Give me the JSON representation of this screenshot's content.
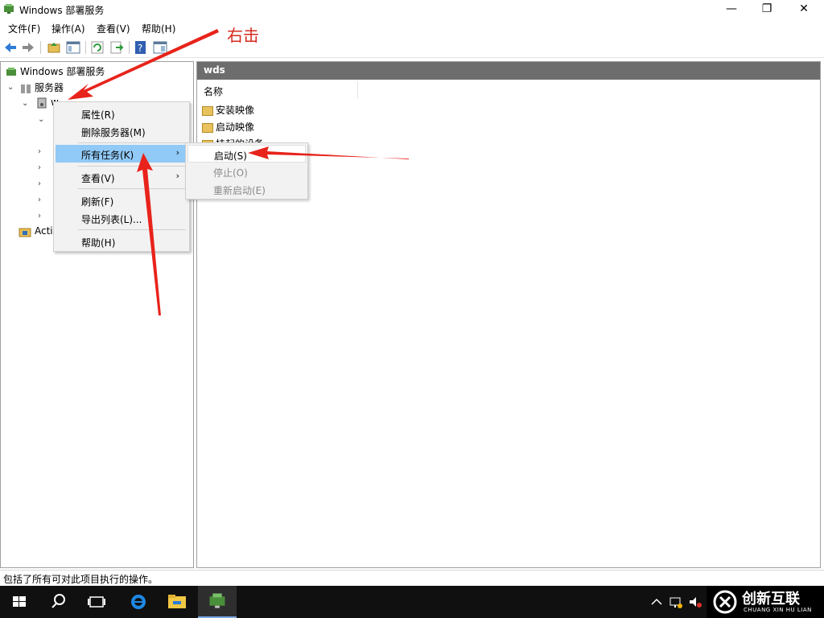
{
  "window": {
    "title": "Windows 部署服务",
    "minimize": "—",
    "restore": "❐",
    "close": "✕"
  },
  "menubar": [
    "文件(F)",
    "操作(A)",
    "查看(V)",
    "帮助(H)"
  ],
  "tree": {
    "root": "Windows 部署服务",
    "servers": "服务器",
    "server_node_partial": "w",
    "active_directory_partial": "Acti"
  },
  "right_pane": {
    "header": "wds",
    "column_name": "名称",
    "items": [
      "安装映像",
      "启动映像",
      "挂起的设备"
    ]
  },
  "context_menu": {
    "items": [
      "属性(R)",
      "删除服务器(M)",
      "所有任务(K)",
      "查看(V)",
      "刷新(F)",
      "导出列表(L)...",
      "帮助(H)"
    ],
    "submenu_arrow": "›"
  },
  "submenu": {
    "items": [
      "启动(S)",
      "停止(O)",
      "重新启动(E)"
    ]
  },
  "status_bar": "包括了所有可对此项目执行的操作。",
  "annotation": "右击",
  "watermark": {
    "brand": "创新互联",
    "sub": "CHUANG XIN HU LIAN"
  },
  "colors": {
    "arrow": "#e8231b",
    "menu_highlight": "#91c9f7",
    "pane_header": "#6d6d6d",
    "taskbar": "#101010"
  }
}
